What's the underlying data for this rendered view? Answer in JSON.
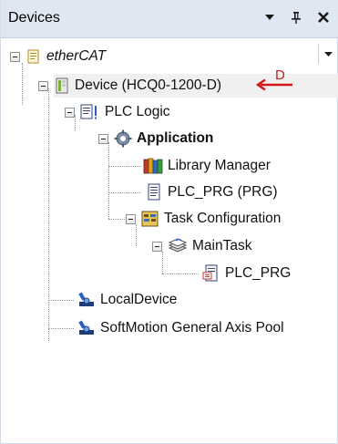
{
  "panel": {
    "title": "Devices",
    "buttons": {
      "menu_icon": "dropdown-triangle",
      "pin_icon": "pin",
      "close_icon": "close"
    }
  },
  "tree": {
    "root": {
      "label": "etherCAT",
      "icon": "project-icon"
    },
    "device": {
      "label": "Device (HCQ0-1200-D)",
      "icon": "device-icon"
    },
    "plc_logic": {
      "label": "PLC Logic",
      "icon": "plc-logic-icon"
    },
    "application": {
      "label": "Application",
      "icon": "gear-icon"
    },
    "library_manager": {
      "label": "Library Manager",
      "icon": "library-icon"
    },
    "plc_prg": {
      "label": "PLC_PRG (PRG)",
      "icon": "pou-icon"
    },
    "task_configuration": {
      "label": "Task Configuration",
      "icon": "task-config-icon"
    },
    "main_task": {
      "label": "MainTask",
      "icon": "task-icon"
    },
    "main_task_plc_prg": {
      "label": "PLC_PRG",
      "icon": "pou-call-icon"
    },
    "local_device": {
      "label": "LocalDevice",
      "icon": "axis-icon"
    },
    "softmotion_pool": {
      "label": "SoftMotion General Axis Pool",
      "icon": "axis-icon"
    }
  },
  "annotation": {
    "label": "D",
    "color": "#d01818"
  }
}
